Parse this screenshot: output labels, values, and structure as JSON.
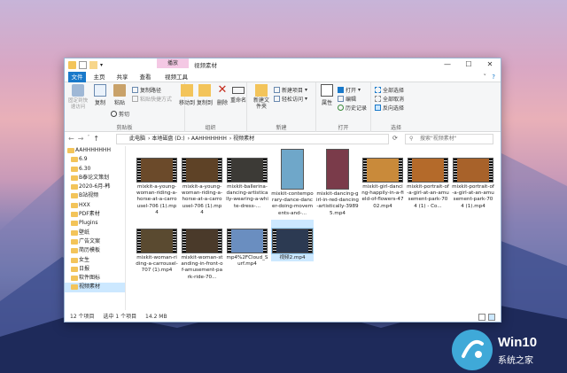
{
  "window": {
    "context_tab": "播放",
    "title": "视频素材",
    "buttons": {
      "minimize": "—",
      "maximize": "☐",
      "close": "✕"
    }
  },
  "tabs": [
    "文件",
    "主页",
    "共享",
    "查看",
    "视频工具"
  ],
  "ribbon": {
    "clipboard": {
      "label": "剪贴板",
      "pin": "固定到快速访问",
      "copy": "复制",
      "paste": "粘贴",
      "copy_path": "复制路径",
      "paste_shortcut": "粘贴快捷方式",
      "cut": "剪切"
    },
    "organize": {
      "label": "组织",
      "move_to": "移动到",
      "copy_to": "复制到",
      "delete": "删除",
      "rename": "重命名"
    },
    "new": {
      "label": "新建",
      "new_folder": "新建文件夹",
      "new_item": "新建项目",
      "easy_access": "轻松访问"
    },
    "open": {
      "label": "打开",
      "properties": "属性",
      "open": "打开",
      "edit": "编辑",
      "history": "历史记录"
    },
    "select": {
      "label": "选择",
      "select_all": "全部选择",
      "select_none": "全部取消",
      "invert": "反向选择"
    }
  },
  "address": {
    "crumbs": [
      "此电脑",
      "本地磁盘 (D:)",
      "AAHHHHHHH",
      "视频素材"
    ],
    "search_placeholder": "搜索\"视频素材\""
  },
  "sidebar": [
    {
      "label": "AAHHHHHHH",
      "level": 0
    },
    {
      "label": "6.9",
      "level": 1
    },
    {
      "label": "6.30",
      "level": 1
    },
    {
      "label": "B泰论文策划",
      "level": 1
    },
    {
      "label": "2020-6月-韩",
      "level": 1
    },
    {
      "label": "B站视频",
      "level": 1
    },
    {
      "label": "HXX",
      "level": 1
    },
    {
      "label": "PDF素材",
      "level": 1
    },
    {
      "label": "Plugins",
      "level": 1
    },
    {
      "label": "壁纸",
      "level": 1
    },
    {
      "label": "广告文案",
      "level": 1
    },
    {
      "label": "简历模板",
      "level": 1
    },
    {
      "label": "女生",
      "level": 1
    },
    {
      "label": "日报",
      "level": 1
    },
    {
      "label": "软件图标",
      "level": 1
    },
    {
      "label": "视频素材",
      "level": 1,
      "selected": true
    }
  ],
  "files": [
    {
      "name": "mixkit-a-young-woman-riding-a-horse-at-a-carrousel-706 (1).mp4",
      "tall": false,
      "color": "#6b4a2a"
    },
    {
      "name": "mixkit-a-young-woman-riding-a-horse-at-a-carrousel-706 (1).mp4",
      "tall": false,
      "color": "#5e4226"
    },
    {
      "name": "mixkit-ballerina-dancing-artistically-wearing-a-white-dress-...",
      "tall": false,
      "color": "#3c3a36"
    },
    {
      "name": "mixkit-contemporary-dance-dancer-doing-movements-and-...",
      "tall": true,
      "color": "#6fa7c9"
    },
    {
      "name": "mixkit-dancing-girl-in-red-dancing-artistically-39895.mp4",
      "tall": true,
      "color": "#7a3b4a"
    },
    {
      "name": "mixkit-girl-dancing-happily-in-a-field-of-flowers-4702.mp4",
      "tall": false,
      "color": "#c98a3a"
    },
    {
      "name": "mixkit-portrait-of-a-girl-at-an-amusement-park-704 (1) - Co...",
      "tall": false,
      "color": "#b46a2a"
    },
    {
      "name": "mixkit-portrait-of-a-girl-at-an-amusement-park-704 (1).mp4",
      "tall": false,
      "color": "#a8622a"
    },
    {
      "name": "mixkit-woman-riding-a-carrousel-707 (1).mp4",
      "tall": false,
      "color": "#5a4a30"
    },
    {
      "name": "mixkit-woman-standing-in-front-of-amusement-park-ride-70...",
      "tall": false,
      "color": "#4a3a2a"
    },
    {
      "name": "mp4%2FCloud_Surf.mp4",
      "tall": false,
      "color": "#6a8ec0"
    },
    {
      "name": "视频2.mp4",
      "tall": false,
      "color": "#2c3a52",
      "selected": true
    }
  ],
  "status": {
    "count": "12 个项目",
    "selected": "选中 1 个项目",
    "size": "14.2 MB"
  },
  "watermark": {
    "title": "Win10",
    "subtitle": "系统之家"
  }
}
